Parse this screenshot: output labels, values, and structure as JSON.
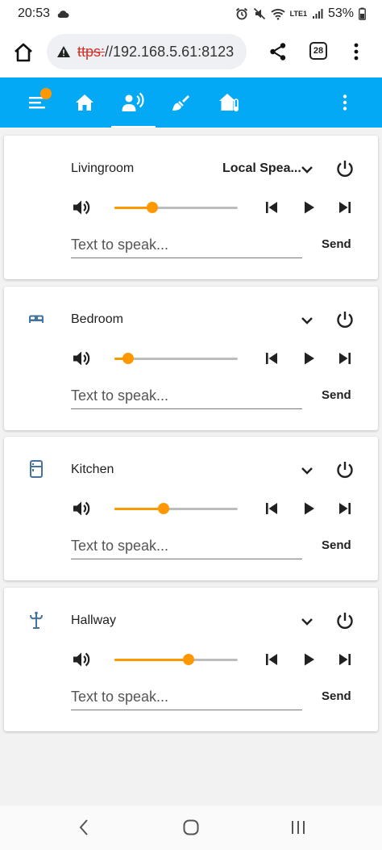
{
  "status_bar": {
    "time": "20:53",
    "battery": "53%",
    "network_label": "LTE1",
    "icons": [
      "cloud-icon",
      "alarm-icon",
      "mute-icon",
      "wifi-icon",
      "signal-icon",
      "battery-icon"
    ]
  },
  "url_bar": {
    "scheme": "ttps:",
    "host": "//192.168.5.61:8123",
    "tab_count": "28",
    "icons": [
      "home-icon",
      "warning-icon",
      "share-icon",
      "tabs-icon",
      "more-vert-icon"
    ]
  },
  "toolbar": {
    "color": "#03a9f4",
    "badge_color": "#ff9800",
    "icons": [
      "menu-icon",
      "home-icon",
      "speaker-icon",
      "brush-icon",
      "home-thermometer-icon",
      "more-vert-icon"
    ]
  },
  "rooms": [
    {
      "name": "Livingroom",
      "icon": "",
      "source": "Local Spea...",
      "volume": 0.31,
      "placeholder": "Text to speak...",
      "send": "Send"
    },
    {
      "name": "Bedroom",
      "icon": "bed-icon",
      "source": "",
      "volume": 0.11,
      "placeholder": "Text to speak...",
      "send": "Send"
    },
    {
      "name": "Kitchen",
      "icon": "fridge-icon",
      "source": "",
      "volume": 0.4,
      "placeholder": "Text to speak...",
      "send": "Send"
    },
    {
      "name": "Hallway",
      "icon": "coat-rack-icon",
      "source": "",
      "volume": 0.6,
      "placeholder": "Text to speak...",
      "send": "Send"
    }
  ],
  "accent_color": "#ff9800",
  "nav_bar": {
    "icons": [
      "back-icon",
      "home-circle-icon",
      "recents-icon"
    ]
  }
}
